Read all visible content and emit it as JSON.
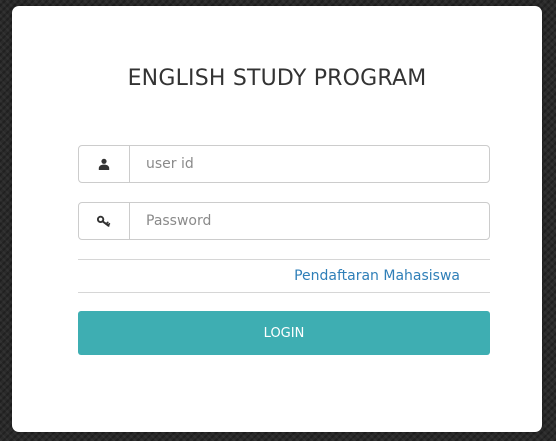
{
  "login_form": {
    "title": "ENGLISH STUDY PROGRAM",
    "user_field": {
      "icon": "user-icon",
      "placeholder": "user id",
      "value": ""
    },
    "password_field": {
      "icon": "key-icon",
      "placeholder": "Password",
      "value": ""
    },
    "register_link_label": "Pendaftaran Mahasiswa",
    "login_button_label": "LOGIN"
  },
  "colors": {
    "accent": "#3eaeb2",
    "link": "#2f7fb8",
    "background": "#2a2a2a",
    "card": "#ffffff"
  }
}
